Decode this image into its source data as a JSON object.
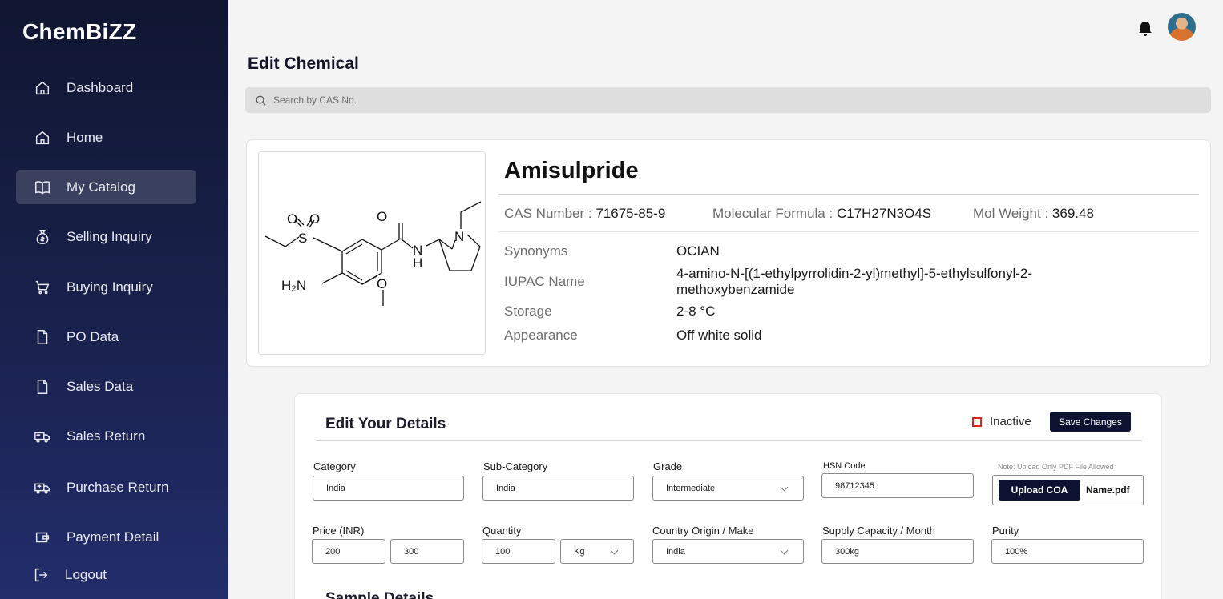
{
  "brand": "ChemBiZZ",
  "sidebar": {
    "items": [
      {
        "label": "Dashboard",
        "icon": "home-icon"
      },
      {
        "label": "Home",
        "icon": "home-icon"
      },
      {
        "label": "My Catalog",
        "icon": "book-icon",
        "active": true
      },
      {
        "label": "Selling Inquiry",
        "icon": "money-bag-icon"
      },
      {
        "label": "Buying Inquiry",
        "icon": "cart-icon"
      },
      {
        "label": "PO Data",
        "icon": "document-icon"
      },
      {
        "label": "Sales Data",
        "icon": "document-icon"
      },
      {
        "label": "Sales Return",
        "icon": "truck-return-icon"
      },
      {
        "label": "Purchase Return",
        "icon": "truck-return-icon"
      },
      {
        "label": "Payment Detail",
        "icon": "wallet-icon"
      },
      {
        "label": "Logout",
        "icon": "logout-icon"
      }
    ]
  },
  "header": {
    "title": "Edit Chemical",
    "search_placeholder": "Search by CAS No."
  },
  "chemical": {
    "name": "Amisulpride",
    "cas_label": "CAS Number :",
    "cas_value": "71675-85-9",
    "formula_label": "Molecular Formula :",
    "formula_value": "C17H27N3O4S",
    "weight_label": "Mol Weight :",
    "weight_value": "369.48",
    "props": [
      {
        "label": "Synonyms",
        "value": "OCIAN"
      },
      {
        "label": "IUPAC Name",
        "value": "4-amino-N-[(1-ethylpyrrolidin-2-yl)methyl]-5-ethylsulfonyl-2-methoxybenzamide"
      },
      {
        "label": "Storage",
        "value": "2-8  °C"
      },
      {
        "label": "Appearance",
        "value": "Off white solid"
      }
    ],
    "structure_atoms": {
      "o1": "O",
      "o2": "O",
      "s": "S",
      "o3": "O",
      "nh_n": "N",
      "nh_h": "H",
      "n": "N",
      "h2n": "H₂N",
      "o4": "O"
    }
  },
  "edit": {
    "title": "Edit Your Details",
    "inactive_label": "Inactive",
    "save_label": "Save Changes",
    "fields": {
      "category": {
        "label": "Category",
        "value": "India"
      },
      "sub_category": {
        "label": "Sub-Category",
        "value": "India"
      },
      "grade": {
        "label": "Grade",
        "value": "Intermediate"
      },
      "hsn": {
        "label": "HSN Code",
        "value": "98712345"
      },
      "price": {
        "label": "Price (INR)",
        "min": "200",
        "max": "300"
      },
      "quantity": {
        "label": "Quantity",
        "value": "100",
        "unit": "Kg"
      },
      "origin": {
        "label": "Country Origin / Make",
        "value": "India"
      },
      "supply": {
        "label": "Supply Capacity / Month",
        "value": "300kg"
      },
      "purity": {
        "label": "Purity",
        "value": "100%"
      }
    },
    "upload_note": "Note: Upload Only PDF File Allowed",
    "upload_label": "Upload COA",
    "upload_file": "Name.pdf",
    "sample_title": "Sample Details"
  }
}
